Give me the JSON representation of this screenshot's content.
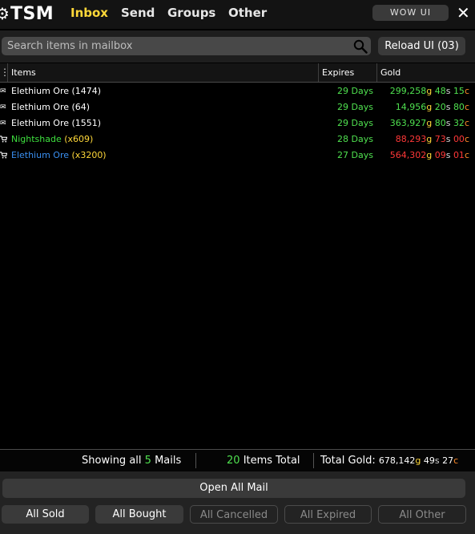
{
  "header": {
    "logo_gear": "⚙",
    "logo_text": "TSM",
    "tabs": [
      {
        "label": "Inbox",
        "active": true
      },
      {
        "label": "Send",
        "active": false
      },
      {
        "label": "Groups",
        "active": false
      },
      {
        "label": "Other",
        "active": false
      }
    ],
    "wow_ui_label": "WOW UI",
    "close_glyph": "✕"
  },
  "search": {
    "placeholder": "Search items in mailbox",
    "reload_label": "Reload UI (03)"
  },
  "table": {
    "columns": [
      "Items",
      "Expires",
      "Gold"
    ],
    "rows": [
      {
        "icon": "envelope-icon",
        "glyph": "✉",
        "name": "Elethium Ore",
        "qty": "(1474)",
        "name_color": "white",
        "qty_color": "white",
        "expires": "29 Days",
        "gold": "299,258",
        "silver": "48",
        "copper": "15",
        "gold_color": "green"
      },
      {
        "icon": "envelope-icon",
        "glyph": "✉",
        "name": "Elethium Ore",
        "qty": "(64)",
        "name_color": "white",
        "qty_color": "white",
        "expires": "29 Days",
        "gold": "14,956",
        "silver": "20",
        "copper": "80",
        "gold_color": "green"
      },
      {
        "icon": "envelope-icon",
        "glyph": "✉",
        "name": "Elethium Ore",
        "qty": "(1551)",
        "name_color": "white",
        "qty_color": "white",
        "expires": "29 Days",
        "gold": "363,927",
        "silver": "80",
        "copper": "32",
        "gold_color": "green"
      },
      {
        "icon": "cart-icon",
        "glyph": "🛒",
        "name": "Nightshade",
        "qty": "(x609)",
        "name_color": "green",
        "qty_color": "yellow",
        "expires": "28 Days",
        "gold": "88,293",
        "silver": "73",
        "copper": "00",
        "gold_color": "red"
      },
      {
        "icon": "cart-icon",
        "glyph": "🛒",
        "name": "Elethium Ore",
        "qty": "(x3200)",
        "name_color": "blue",
        "qty_color": "yellow",
        "expires": "27 Days",
        "gold": "564,302",
        "silver": "09",
        "copper": "01",
        "gold_color": "red"
      }
    ]
  },
  "summary": {
    "showing_prefix": "Showing all",
    "mail_count": "5",
    "showing_suffix": "Mails",
    "items_count": "20",
    "items_suffix": "Items Total",
    "total_gold_label": "Total Gold:",
    "total_gold": "678,142",
    "total_silver": "49",
    "total_copper": "27"
  },
  "currency": {
    "g": "g",
    "s": "s",
    "c": "c"
  },
  "actions": {
    "open_all": "Open All Mail",
    "filters": [
      {
        "label": "All Sold",
        "enabled": true
      },
      {
        "label": "All Bought",
        "enabled": true
      },
      {
        "label": "All Cancelled",
        "enabled": false
      },
      {
        "label": "All Expired",
        "enabled": false
      },
      {
        "label": "All Other",
        "enabled": false
      }
    ]
  },
  "colors": {
    "active_tab": "#ffd839",
    "gold_green": "#4fe04f",
    "gold_red": "#ff3838",
    "currency_gold": "#ffd839",
    "currency_copper": "#ff8c2a",
    "item_blue": "#3a8ff0"
  }
}
